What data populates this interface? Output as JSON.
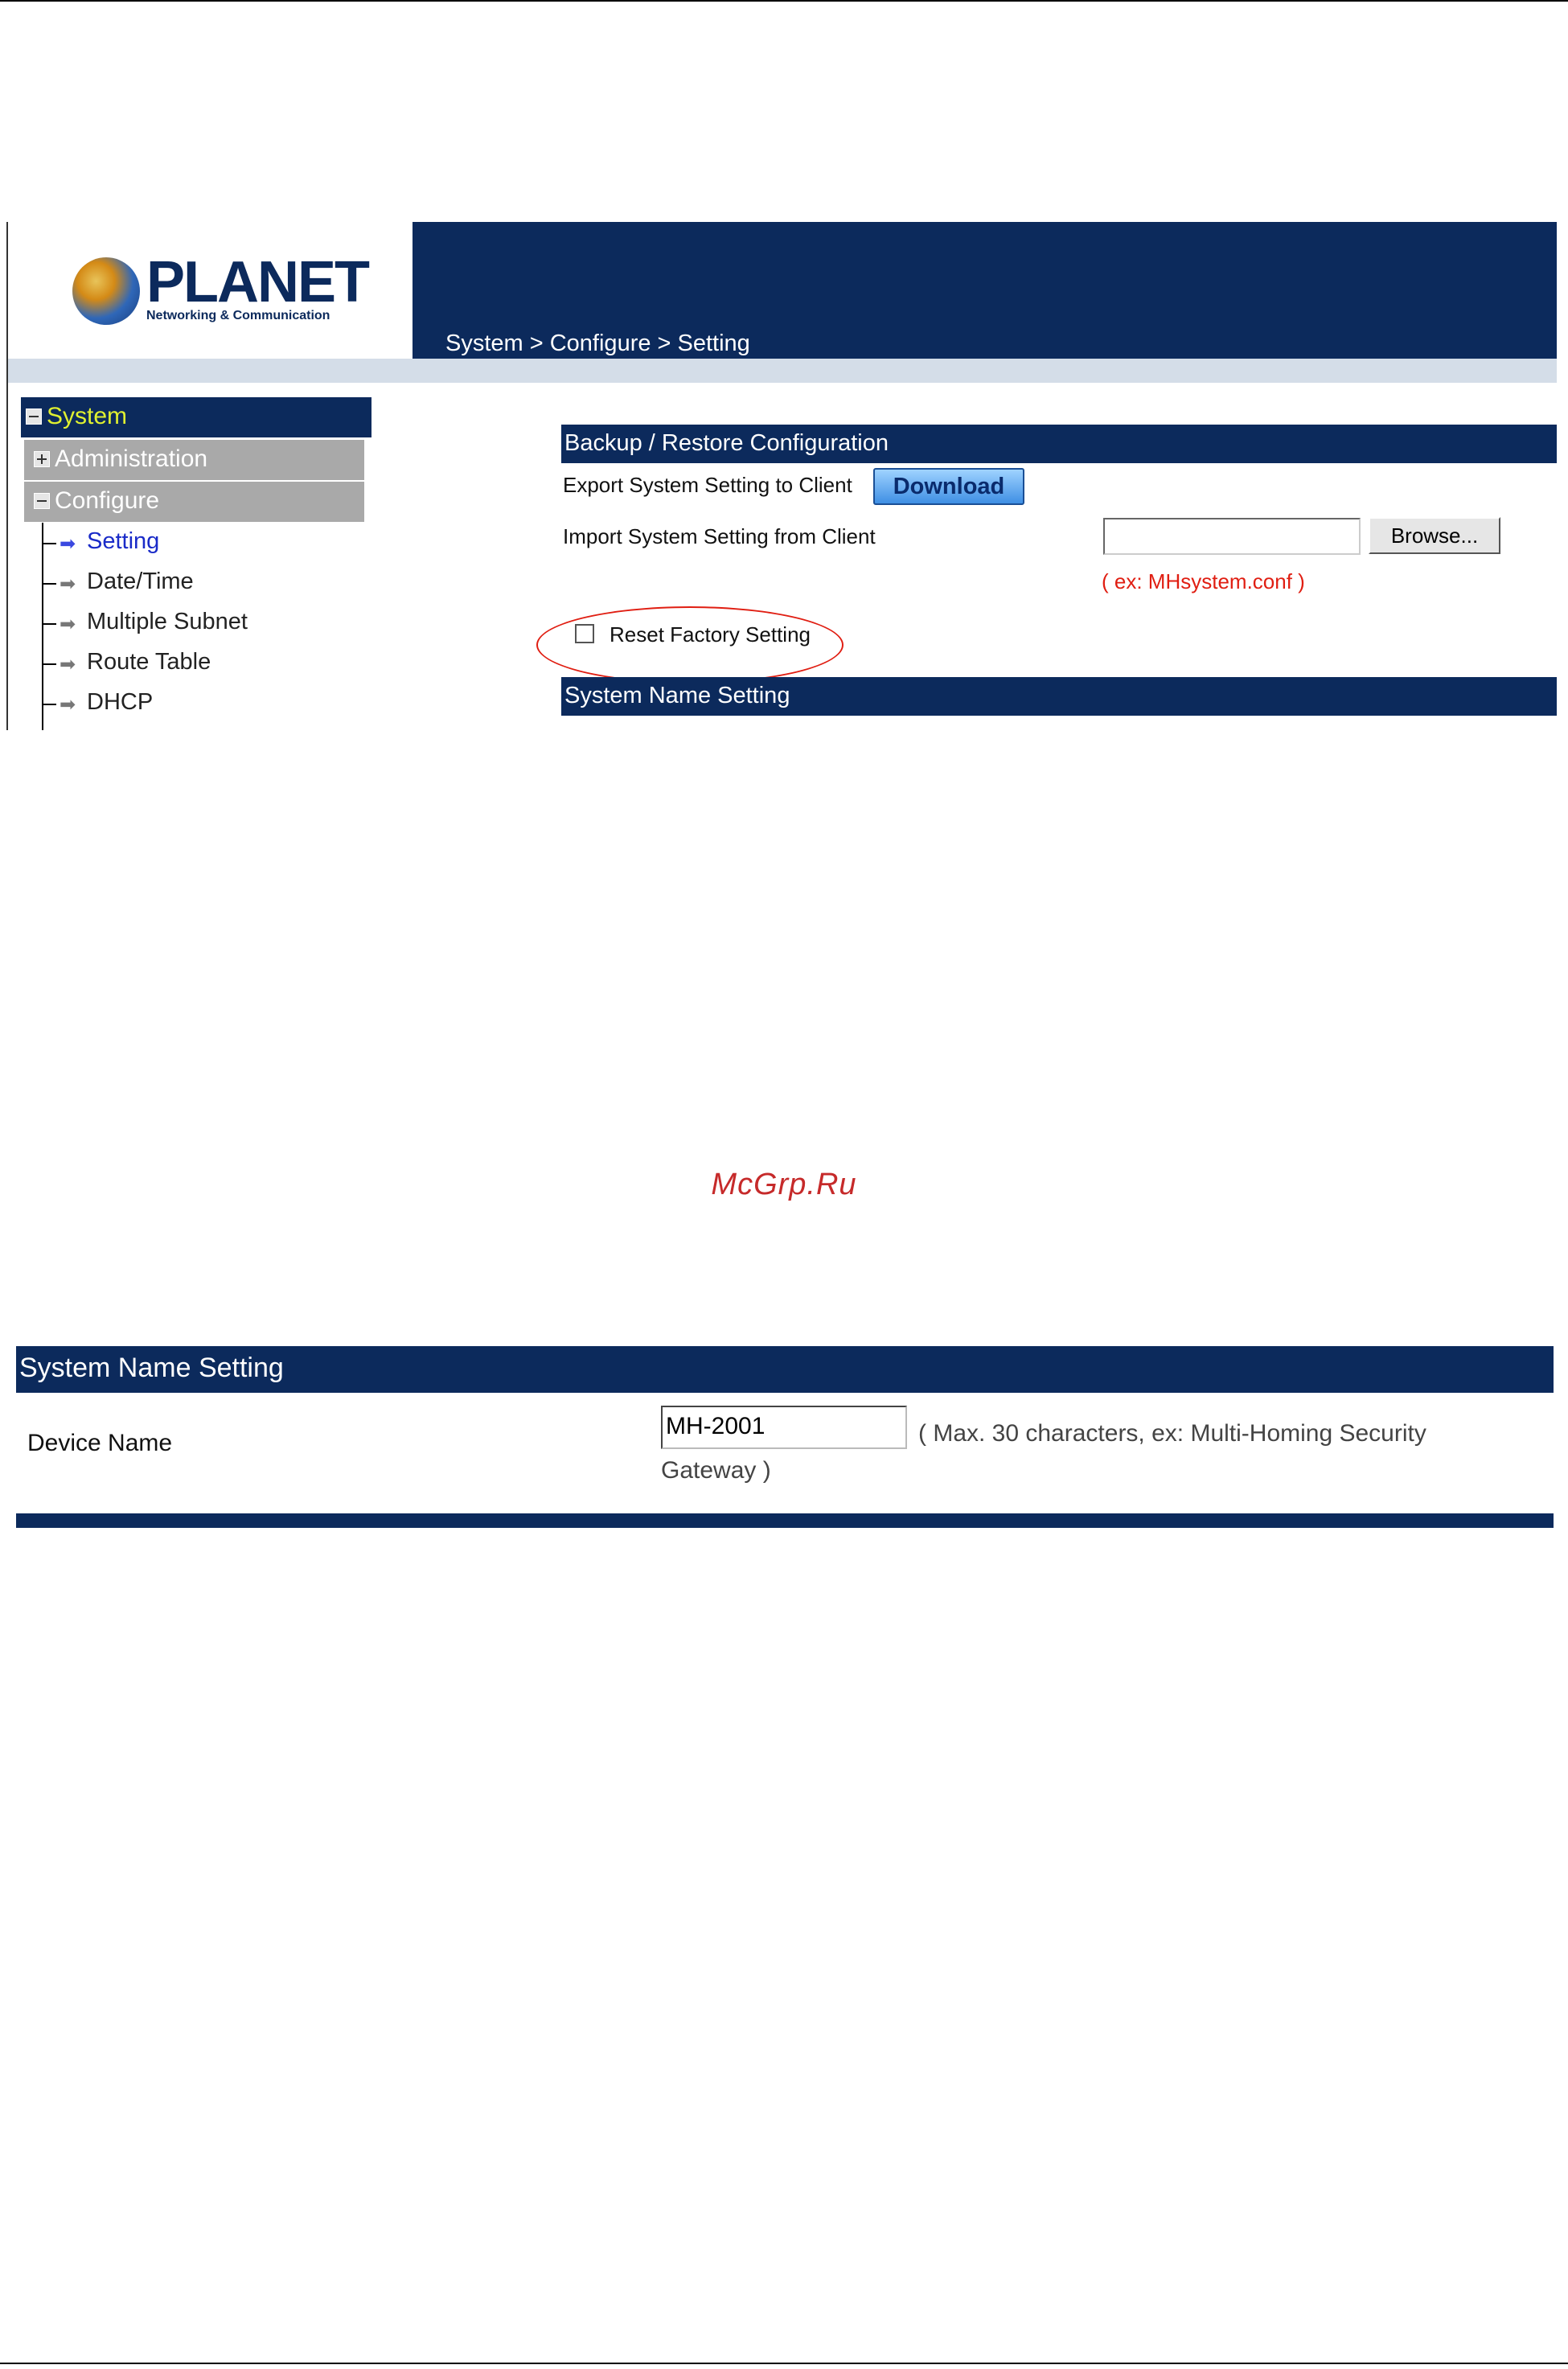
{
  "screenshot1": {
    "logo": {
      "brand": "PLANET",
      "tagline": "Networking & Communication"
    },
    "breadcrumb": "System > Configure > Setting",
    "sidebar": {
      "system_label": "System",
      "administration_label": "Administration",
      "configure_label": "Configure",
      "items": [
        {
          "label": "Setting",
          "active": true
        },
        {
          "label": "Date/Time",
          "active": false
        },
        {
          "label": "Multiple Subnet",
          "active": false
        },
        {
          "label": "Route Table",
          "active": false
        },
        {
          "label": "DHCP",
          "active": false
        }
      ]
    },
    "backup": {
      "title": "Backup / Restore Configuration",
      "export_label": "Export System Setting to Client",
      "download_button": "Download",
      "import_label": "Import System Setting from Client",
      "file_value": "",
      "browse_button": "Browse...",
      "example_hint": "( ex: MHsystem.conf )",
      "reset_label": "Reset Factory Setting",
      "reset_checked": false
    },
    "system_name_title": "System Name Setting"
  },
  "watermark": "McGrp.Ru",
  "screenshot2": {
    "title": "System Name Setting",
    "device_name_label": "Device Name",
    "device_name_value": "MH-2001",
    "device_name_hint": "( Max. 30 characters, ex: Multi-Homing Security Gateway )"
  },
  "colors": {
    "navy": "#0c2a5c",
    "hint_red": "#e01e12",
    "sidebar_gray": "#a9a9a9",
    "system_yellow": "#e0f030"
  }
}
